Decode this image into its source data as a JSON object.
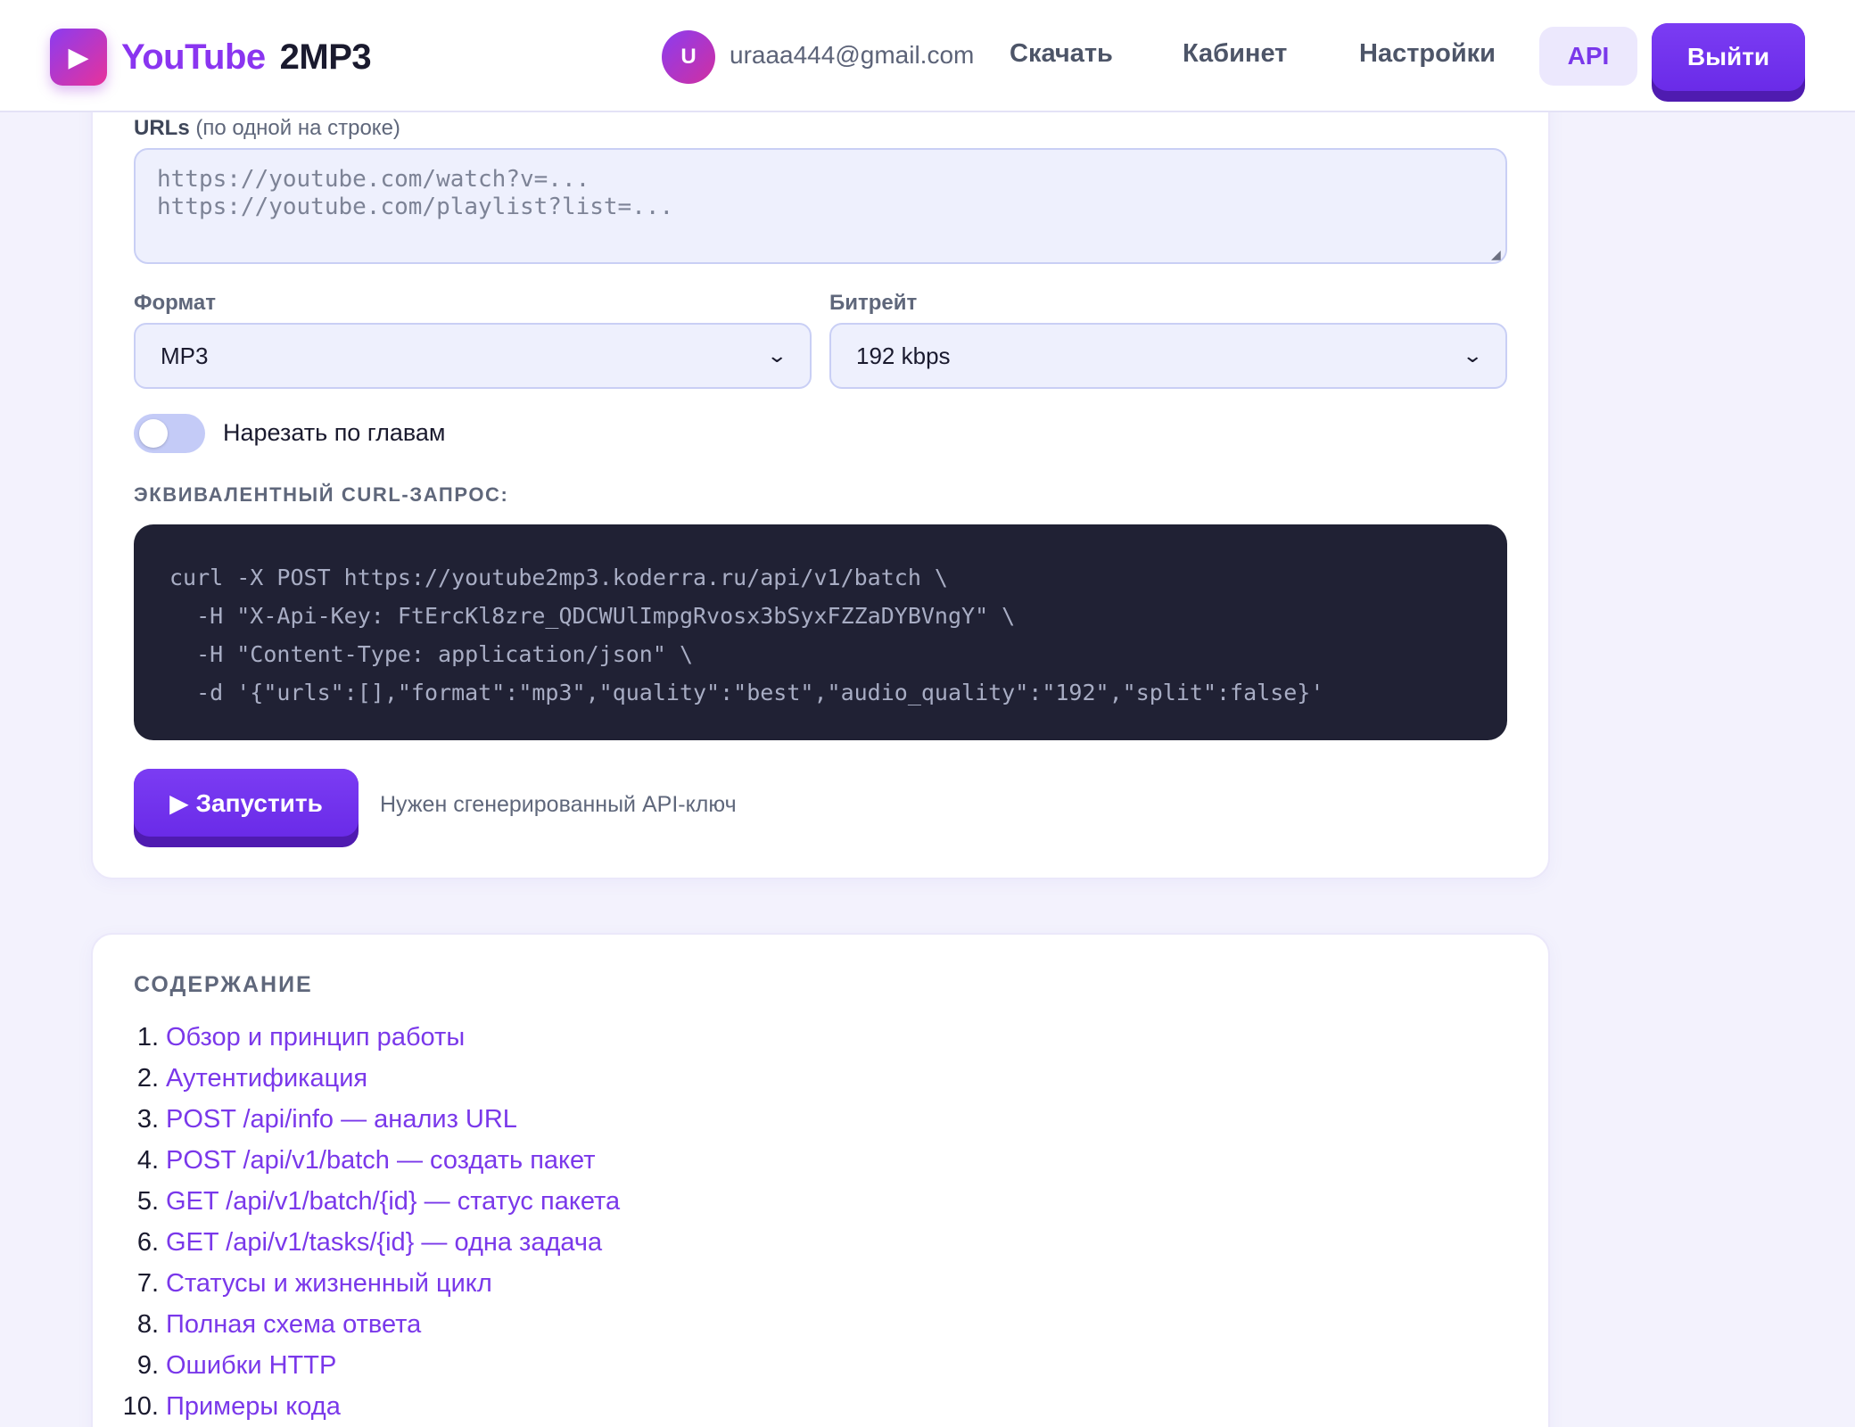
{
  "header": {
    "logo_icon": "▶",
    "logo_youtube": "YouTube",
    "logo_2mp3": "2MP3",
    "avatar_letter": "U",
    "email": "uraaa444@gmail.com",
    "nav": {
      "download": "Скачать",
      "cabinet": "Кабинет",
      "settings": "Настройки",
      "api": "API",
      "logout": "Выйти"
    }
  },
  "form": {
    "urls_label_bold": "URLs",
    "urls_label_hint": "(по одной на строке)",
    "urls_placeholder": "https://youtube.com/watch?v=...\nhttps://youtube.com/playlist?list=...",
    "format_label": "Формат",
    "format_value": "MP3",
    "bitrate_label": "Битрейт",
    "bitrate_value": "192 kbps",
    "split_toggle_label": "Нарезать по главам",
    "split_toggle_on": false,
    "curl_label": "ЭКВИВАЛЕНТНЫЙ CURL-ЗАПРОС:",
    "curl_code": "curl -X POST https://youtube2mp3.koderra.ru/api/v1/batch \\\n  -H \"X-Api-Key: FtErcKl8zre_QDCWUlImpgRvosx3bSyxFZZaDYBVngY\" \\\n  -H \"Content-Type: application/json\" \\\n  -d '{\"urls\":[],\"format\":\"mp3\",\"quality\":\"best\",\"audio_quality\":\"192\",\"split\":false}'",
    "run_button": "▶ Запустить",
    "run_hint": "Нужен сгенерированный API-ключ"
  },
  "toc": {
    "title": "СОДЕРЖАНИЕ",
    "items": [
      {
        "num": "1.",
        "label": "Обзор и принцип работы"
      },
      {
        "num": "2.",
        "label": "Аутентификация"
      },
      {
        "num": "3.",
        "label": "POST /api/info — анализ URL"
      },
      {
        "num": "4.",
        "label": "POST /api/v1/batch — создать пакет"
      },
      {
        "num": "5.",
        "label": "GET /api/v1/batch/{id} — статус пакета"
      },
      {
        "num": "6.",
        "label": "GET /api/v1/tasks/{id} — одна задача"
      },
      {
        "num": "7.",
        "label": "Статусы и жизненный цикл"
      },
      {
        "num": "8.",
        "label": "Полная схема ответа"
      },
      {
        "num": "9.",
        "label": "Ошибки HTTP"
      },
      {
        "num": "10.",
        "label": "Примеры кода"
      }
    ]
  },
  "colors": {
    "accent": "#7a38ea",
    "accent_dark": "#4f1bb0",
    "background": "#f3f2fd",
    "code_bg": "#202134"
  },
  "icons": {
    "logo": "play-icon",
    "select_arrow": "chevron-down-icon"
  }
}
